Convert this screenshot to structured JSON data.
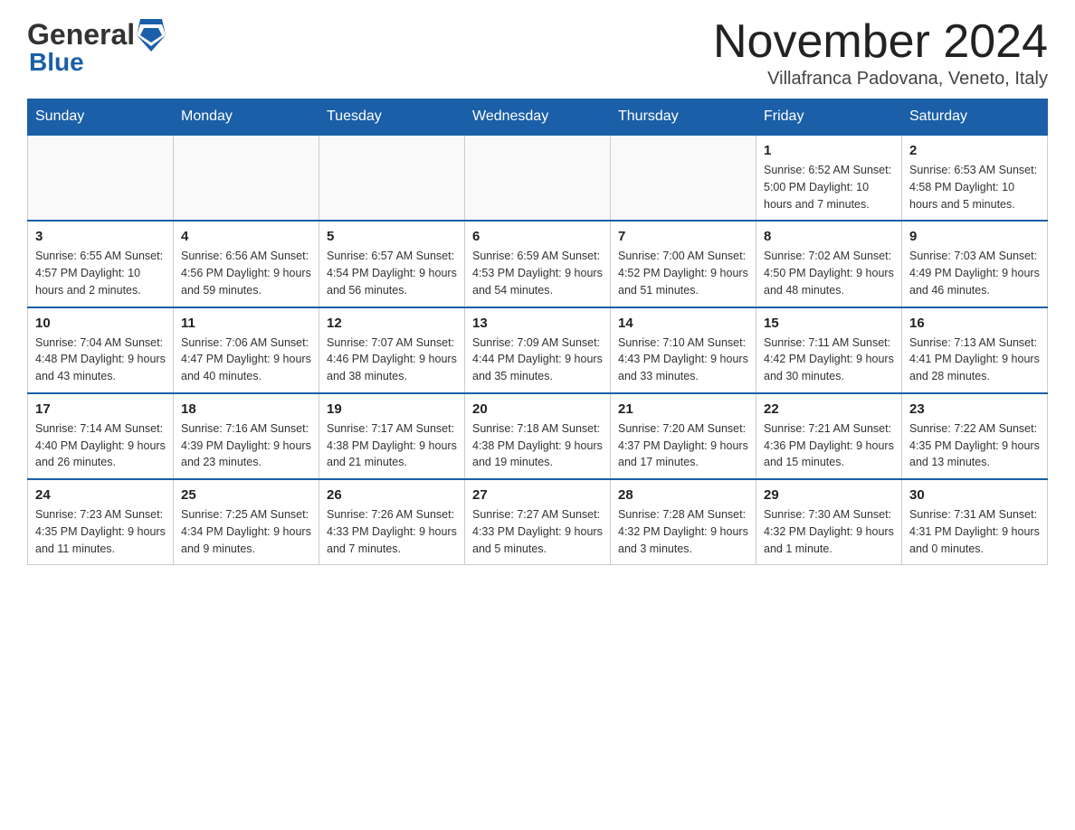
{
  "header": {
    "logo_general": "General",
    "logo_blue": "Blue",
    "month_title": "November 2024",
    "location": "Villafranca Padovana, Veneto, Italy"
  },
  "days_of_week": [
    "Sunday",
    "Monday",
    "Tuesday",
    "Wednesday",
    "Thursday",
    "Friday",
    "Saturday"
  ],
  "weeks": [
    [
      {
        "day": "",
        "info": ""
      },
      {
        "day": "",
        "info": ""
      },
      {
        "day": "",
        "info": ""
      },
      {
        "day": "",
        "info": ""
      },
      {
        "day": "",
        "info": ""
      },
      {
        "day": "1",
        "info": "Sunrise: 6:52 AM\nSunset: 5:00 PM\nDaylight: 10 hours and 7 minutes."
      },
      {
        "day": "2",
        "info": "Sunrise: 6:53 AM\nSunset: 4:58 PM\nDaylight: 10 hours and 5 minutes."
      }
    ],
    [
      {
        "day": "3",
        "info": "Sunrise: 6:55 AM\nSunset: 4:57 PM\nDaylight: 10 hours and 2 minutes."
      },
      {
        "day": "4",
        "info": "Sunrise: 6:56 AM\nSunset: 4:56 PM\nDaylight: 9 hours and 59 minutes."
      },
      {
        "day": "5",
        "info": "Sunrise: 6:57 AM\nSunset: 4:54 PM\nDaylight: 9 hours and 56 minutes."
      },
      {
        "day": "6",
        "info": "Sunrise: 6:59 AM\nSunset: 4:53 PM\nDaylight: 9 hours and 54 minutes."
      },
      {
        "day": "7",
        "info": "Sunrise: 7:00 AM\nSunset: 4:52 PM\nDaylight: 9 hours and 51 minutes."
      },
      {
        "day": "8",
        "info": "Sunrise: 7:02 AM\nSunset: 4:50 PM\nDaylight: 9 hours and 48 minutes."
      },
      {
        "day": "9",
        "info": "Sunrise: 7:03 AM\nSunset: 4:49 PM\nDaylight: 9 hours and 46 minutes."
      }
    ],
    [
      {
        "day": "10",
        "info": "Sunrise: 7:04 AM\nSunset: 4:48 PM\nDaylight: 9 hours and 43 minutes."
      },
      {
        "day": "11",
        "info": "Sunrise: 7:06 AM\nSunset: 4:47 PM\nDaylight: 9 hours and 40 minutes."
      },
      {
        "day": "12",
        "info": "Sunrise: 7:07 AM\nSunset: 4:46 PM\nDaylight: 9 hours and 38 minutes."
      },
      {
        "day": "13",
        "info": "Sunrise: 7:09 AM\nSunset: 4:44 PM\nDaylight: 9 hours and 35 minutes."
      },
      {
        "day": "14",
        "info": "Sunrise: 7:10 AM\nSunset: 4:43 PM\nDaylight: 9 hours and 33 minutes."
      },
      {
        "day": "15",
        "info": "Sunrise: 7:11 AM\nSunset: 4:42 PM\nDaylight: 9 hours and 30 minutes."
      },
      {
        "day": "16",
        "info": "Sunrise: 7:13 AM\nSunset: 4:41 PM\nDaylight: 9 hours and 28 minutes."
      }
    ],
    [
      {
        "day": "17",
        "info": "Sunrise: 7:14 AM\nSunset: 4:40 PM\nDaylight: 9 hours and 26 minutes."
      },
      {
        "day": "18",
        "info": "Sunrise: 7:16 AM\nSunset: 4:39 PM\nDaylight: 9 hours and 23 minutes."
      },
      {
        "day": "19",
        "info": "Sunrise: 7:17 AM\nSunset: 4:38 PM\nDaylight: 9 hours and 21 minutes."
      },
      {
        "day": "20",
        "info": "Sunrise: 7:18 AM\nSunset: 4:38 PM\nDaylight: 9 hours and 19 minutes."
      },
      {
        "day": "21",
        "info": "Sunrise: 7:20 AM\nSunset: 4:37 PM\nDaylight: 9 hours and 17 minutes."
      },
      {
        "day": "22",
        "info": "Sunrise: 7:21 AM\nSunset: 4:36 PM\nDaylight: 9 hours and 15 minutes."
      },
      {
        "day": "23",
        "info": "Sunrise: 7:22 AM\nSunset: 4:35 PM\nDaylight: 9 hours and 13 minutes."
      }
    ],
    [
      {
        "day": "24",
        "info": "Sunrise: 7:23 AM\nSunset: 4:35 PM\nDaylight: 9 hours and 11 minutes."
      },
      {
        "day": "25",
        "info": "Sunrise: 7:25 AM\nSunset: 4:34 PM\nDaylight: 9 hours and 9 minutes."
      },
      {
        "day": "26",
        "info": "Sunrise: 7:26 AM\nSunset: 4:33 PM\nDaylight: 9 hours and 7 minutes."
      },
      {
        "day": "27",
        "info": "Sunrise: 7:27 AM\nSunset: 4:33 PM\nDaylight: 9 hours and 5 minutes."
      },
      {
        "day": "28",
        "info": "Sunrise: 7:28 AM\nSunset: 4:32 PM\nDaylight: 9 hours and 3 minutes."
      },
      {
        "day": "29",
        "info": "Sunrise: 7:30 AM\nSunset: 4:32 PM\nDaylight: 9 hours and 1 minute."
      },
      {
        "day": "30",
        "info": "Sunrise: 7:31 AM\nSunset: 4:31 PM\nDaylight: 9 hours and 0 minutes."
      }
    ]
  ]
}
